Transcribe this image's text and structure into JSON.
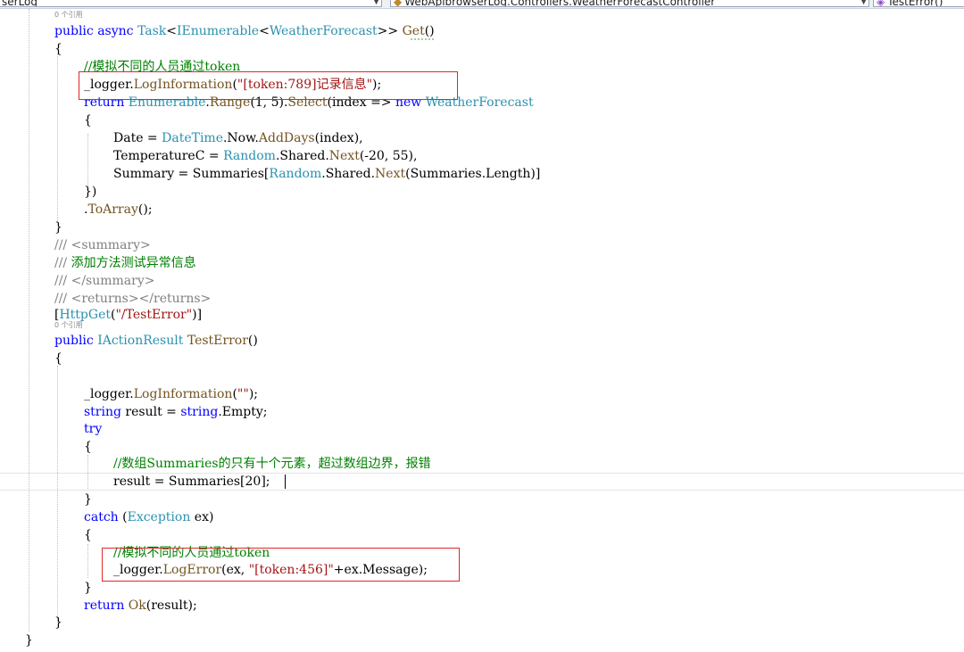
{
  "navbar": {
    "project": "serLog",
    "class": "WebApibrowserLog.Controllers.WeatherForecastController",
    "member": "TestError()"
  },
  "reference_count_label": "0 个引用",
  "code": {
    "l01": [
      [
        "kw",
        "public"
      ],
      [
        "p",
        " "
      ],
      [
        "kw",
        "async"
      ],
      [
        "p",
        " "
      ],
      [
        "type",
        "Task"
      ],
      [
        "p",
        "<"
      ],
      [
        "type",
        "IEnumerable"
      ],
      [
        "p",
        "<"
      ],
      [
        "type",
        "WeatherForecast"
      ],
      [
        "p",
        ">> "
      ],
      [
        "method",
        "Get"
      ],
      [
        "p",
        "()"
      ]
    ],
    "l02": [
      [
        "p",
        "{"
      ]
    ],
    "l03": [
      [
        "cmt",
        "//模拟不同的人员通过token"
      ]
    ],
    "l04": [
      [
        "p",
        "_logger."
      ],
      [
        "method",
        "LogInformation"
      ],
      [
        "p",
        "("
      ],
      [
        "str",
        "\"[token:789]记录信息\""
      ],
      [
        "p",
        ");"
      ]
    ],
    "l05": [
      [
        "kw",
        "return"
      ],
      [
        "p",
        " "
      ],
      [
        "type",
        "Enumerable"
      ],
      [
        "p",
        "."
      ],
      [
        "method",
        "Range"
      ],
      [
        "p",
        "(1, 5)."
      ],
      [
        "method",
        "Select"
      ],
      [
        "p",
        "(index => "
      ],
      [
        "kw",
        "new"
      ],
      [
        "p",
        " "
      ],
      [
        "type",
        "WeatherForecast"
      ]
    ],
    "l06": [
      [
        "p",
        "{"
      ]
    ],
    "l07": [
      [
        "p",
        "Date = "
      ],
      [
        "type",
        "DateTime"
      ],
      [
        "p",
        ".Now."
      ],
      [
        "method",
        "AddDays"
      ],
      [
        "p",
        "(index),"
      ]
    ],
    "l08": [
      [
        "p",
        "TemperatureC = "
      ],
      [
        "type",
        "Random"
      ],
      [
        "p",
        ".Shared."
      ],
      [
        "method",
        "Next"
      ],
      [
        "p",
        "(-20, 55),"
      ]
    ],
    "l09": [
      [
        "p",
        "Summary = Summaries["
      ],
      [
        "type",
        "Random"
      ],
      [
        "p",
        ".Shared."
      ],
      [
        "method",
        "Next"
      ],
      [
        "p",
        "(Summaries.Length)]"
      ]
    ],
    "l10": [
      [
        "p",
        "})"
      ]
    ],
    "l11": [
      [
        "p",
        "."
      ],
      [
        "method",
        "ToArray"
      ],
      [
        "p",
        "();"
      ]
    ],
    "l12": [
      [
        "p",
        "}"
      ]
    ],
    "l13": [
      [
        "doc",
        "/// <summary>"
      ]
    ],
    "l14": [
      [
        "doc",
        "/// "
      ],
      [
        "cmt",
        "添加方法测试异常信息"
      ]
    ],
    "l15": [
      [
        "doc",
        "/// </summary>"
      ]
    ],
    "l16": [
      [
        "doc",
        "/// <returns></returns>"
      ]
    ],
    "l17": [
      [
        "p",
        "["
      ],
      [
        "type",
        "HttpGet"
      ],
      [
        "p",
        "("
      ],
      [
        "str",
        "\"/TestError\""
      ],
      [
        "p",
        ")]"
      ]
    ],
    "l18": [
      [
        "kw",
        "public"
      ],
      [
        "p",
        " "
      ],
      [
        "type",
        "IActionResult"
      ],
      [
        "p",
        " "
      ],
      [
        "method",
        "TestError"
      ],
      [
        "p",
        "()"
      ]
    ],
    "l19": [
      [
        "p",
        "{"
      ]
    ],
    "l20": [
      [
        "p",
        "_logger."
      ],
      [
        "method",
        "LogInformation"
      ],
      [
        "p",
        "("
      ],
      [
        "str",
        "\"\""
      ],
      [
        "p",
        ");"
      ]
    ],
    "l21": [
      [
        "kw",
        "string"
      ],
      [
        "p",
        " result = "
      ],
      [
        "kw",
        "string"
      ],
      [
        "p",
        ".Empty;"
      ]
    ],
    "l22": [
      [
        "kw",
        "try"
      ]
    ],
    "l23": [
      [
        "p",
        "{"
      ]
    ],
    "l24": [
      [
        "cmt",
        "//数组Summaries的只有十个元素，超过数组边界，报错"
      ]
    ],
    "l25": [
      [
        "p",
        "result = Summaries[20];"
      ]
    ],
    "l26": [
      [
        "p",
        "}"
      ]
    ],
    "l27": [
      [
        "kw",
        "catch"
      ],
      [
        "p",
        " ("
      ],
      [
        "type",
        "Exception"
      ],
      [
        "p",
        " ex)"
      ]
    ],
    "l28": [
      [
        "p",
        "{"
      ]
    ],
    "l29": [
      [
        "cmt",
        "//模拟不同的人员通过token"
      ]
    ],
    "l30": [
      [
        "p",
        "_logger."
      ],
      [
        "method",
        "LogError"
      ],
      [
        "p",
        "(ex, "
      ],
      [
        "str",
        "\"[token:456]\""
      ],
      [
        "p",
        "+ex.Message);"
      ]
    ],
    "l31": [
      [
        "p",
        "}"
      ]
    ],
    "l32": [
      [
        "kw",
        "return"
      ],
      [
        "p",
        " "
      ],
      [
        "method",
        "Ok"
      ],
      [
        "p",
        "(result);"
      ]
    ],
    "l33": [
      [
        "p",
        "}"
      ]
    ],
    "l34": [
      [
        "p",
        "}"
      ]
    ]
  }
}
